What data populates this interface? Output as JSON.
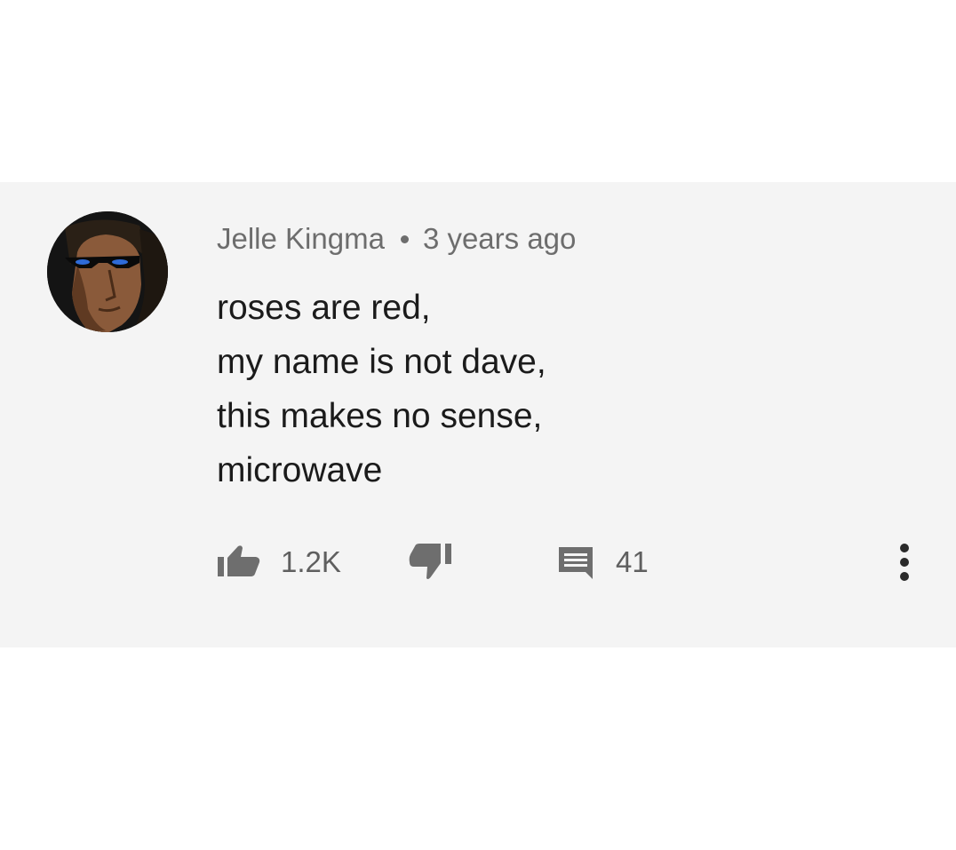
{
  "comment": {
    "author": "Jelle Kingma",
    "separator_icon": "dot-separator-icon",
    "timestamp": "3 years ago",
    "avatar": "user-avatar-sunglasses",
    "lines": [
      "roses are red,",
      "my name is not dave,",
      "this makes no sense,",
      "microwave"
    ]
  },
  "actions": {
    "like": {
      "icon": "thumbs-up-icon",
      "count": "1.2K"
    },
    "dislike": {
      "icon": "thumbs-down-icon"
    },
    "reply": {
      "icon": "comment-icon",
      "count": "41"
    },
    "more": {
      "icon": "more-vertical-icon"
    }
  },
  "colors": {
    "card_background": "#f4f4f4",
    "page_background": "#ffffff",
    "text_primary": "#1b1b1b",
    "text_secondary": "#6d6d6d",
    "icon": "#6e6e6e"
  }
}
